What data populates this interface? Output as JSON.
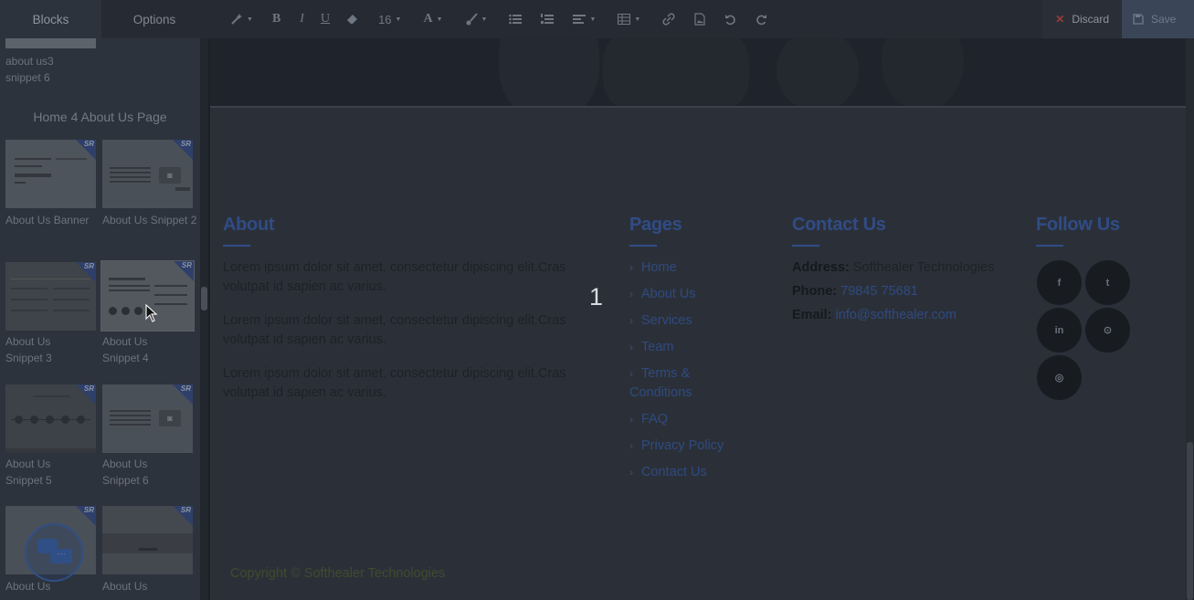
{
  "topbar": {
    "tabs": [
      {
        "label": "Blocks",
        "active": true
      },
      {
        "label": "Options",
        "active": false
      }
    ],
    "tools": {
      "font_size": "16",
      "icons": [
        "magic-wand-icon",
        "bold-icon",
        "italic-icon",
        "underline-icon",
        "eraser-icon",
        "font-size-select",
        "font-color-icon",
        "paint-brush-icon",
        "unordered-list-icon",
        "ordered-list-icon",
        "align-icon",
        "table-icon",
        "link-icon",
        "image-file-icon",
        "undo-icon",
        "redo-icon"
      ]
    },
    "discard_label": "Discard",
    "save_label": "Save"
  },
  "sidebar": {
    "prev_snippet_caption": "about us3 snippet 6",
    "section_title": "Home 4 About Us Page",
    "snippets": [
      {
        "caption": "About Us Banner"
      },
      {
        "caption": "About Us Snippet 2"
      },
      {
        "caption": "About Us Snippet 3"
      },
      {
        "caption": "About Us Snippet 4"
      },
      {
        "caption": "About Us Snippet 5"
      },
      {
        "caption": "About Us Snippet 6"
      },
      {
        "caption": "About Us"
      },
      {
        "caption": "About Us"
      }
    ],
    "badge_text": "SR"
  },
  "main": {
    "about": {
      "title": "About",
      "paragraphs": [
        "Lorem ipsum dolor sit amet, consectetur dipiscing elit.Cras volutpat id sapien ac varius.",
        "Lorem ipsum dolor sit amet, consectetur dipiscing elit.Cras volutpat id sapien ac varius.",
        "Lorem ipsum dolor sit amet, consectetur dipiscing elit.Cras volutpat id sapien ac varius."
      ]
    },
    "overlay_number": "1",
    "pages": {
      "title": "Pages",
      "links": [
        "Home",
        "About Us",
        "Services",
        "Team",
        "Terms & Conditions",
        "FAQ",
        "Privacy Policy",
        "Contact Us"
      ]
    },
    "contact": {
      "title": "Contact Us",
      "address_label": "Address:",
      "address_value": "Softhealer Technologies",
      "phone_label": "Phone:",
      "phone_value": "79845 75681",
      "email_label": "Email:",
      "email_value": "info@softhealer.com"
    },
    "follow": {
      "title": "Follow Us",
      "icons": [
        {
          "name": "facebook-icon",
          "glyph": "f"
        },
        {
          "name": "twitter-icon",
          "glyph": "t"
        },
        {
          "name": "linkedin-icon",
          "glyph": "in"
        },
        {
          "name": "github-icon",
          "glyph": "⊙"
        },
        {
          "name": "instagram-icon",
          "glyph": "◎"
        }
      ]
    },
    "copyright": "Copyright © Softhealer Technologies"
  },
  "colors": {
    "accent": "#304c86",
    "overlay": "#2b3038",
    "discard_x": "#9c3b35"
  }
}
